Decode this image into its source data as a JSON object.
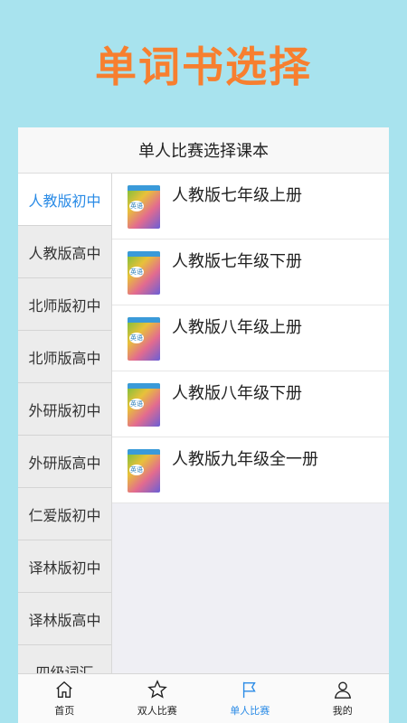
{
  "hero": {
    "title": "单词书选择"
  },
  "header": {
    "title": "单人比赛选择课本"
  },
  "sidebar": {
    "items": [
      {
        "label": "人教版初中"
      },
      {
        "label": "人教版高中"
      },
      {
        "label": "北师版初中"
      },
      {
        "label": "北师版高中"
      },
      {
        "label": "外研版初中"
      },
      {
        "label": "外研版高中"
      },
      {
        "label": "仁爱版初中"
      },
      {
        "label": "译林版初中"
      },
      {
        "label": "译林版高中"
      },
      {
        "label": "四级词汇"
      }
    ]
  },
  "books": [
    {
      "title": "人教版七年级上册",
      "badge": "英语"
    },
    {
      "title": "人教版七年级下册",
      "badge": "英语"
    },
    {
      "title": "人教版八年级上册",
      "badge": "英语"
    },
    {
      "title": "人教版八年级下册",
      "badge": "英语"
    },
    {
      "title": "人教版九年级全一册",
      "badge": "英语"
    }
  ],
  "tabbar": {
    "tabs": [
      {
        "label": "首页",
        "icon": "home-icon"
      },
      {
        "label": "双人比赛",
        "icon": "star-icon"
      },
      {
        "label": "单人比赛",
        "icon": "flag-icon"
      },
      {
        "label": "我的",
        "icon": "user-icon"
      }
    ]
  },
  "colors": {
    "accent": "#2a8be6",
    "hero": "#f77f2f",
    "background": "#a8e3ee"
  }
}
